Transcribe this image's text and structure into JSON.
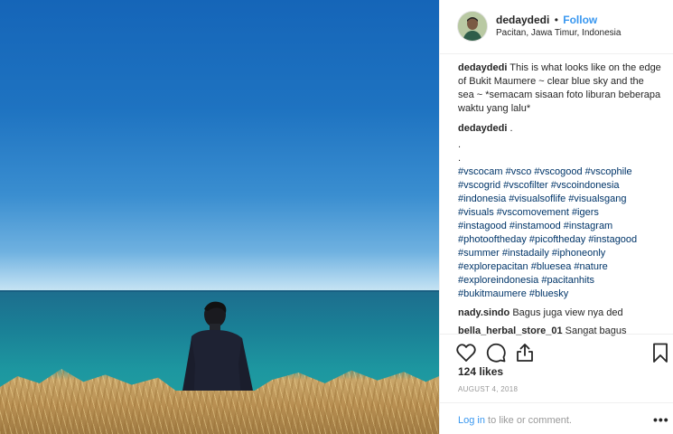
{
  "header": {
    "username": "dedaydedi",
    "separator": "•",
    "follow_label": "Follow",
    "location": "Pacitan, Jawa Timur, Indonesia"
  },
  "caption": {
    "username": "dedaydedi",
    "text": "This is what looks like on the edge of Bukit Maumere ~ clear blue sky and the sea ~ *semacam sisaan foto liburan beberapa waktu yang lalu*"
  },
  "comment2": {
    "username": "dedaydedi",
    "text": ".",
    "dot1": ".",
    "dot2": ".",
    "tag_lines": [
      "#vscocam #vsco #vscogood #vscophile",
      "#vscogrid #vscofilter #vscoindonesia",
      "#indonesia #visualsoflife #visualsgang",
      "#visuals #vscomovement #igers",
      "#instagood #instamood #instagram",
      "#photooftheday #picoftheday #instagood",
      "#summer #instadaily #iphoneonly",
      "#explorepacitan #bluesea #nature",
      "#exploreindonesia #pacitanhits",
      "#bukitmaumere #bluesky"
    ]
  },
  "comment3": {
    "username": "nady.sindo",
    "text": "Bagus juga view nya ded"
  },
  "comment4": {
    "username": "bella_herbal_store_01",
    "text": "Sangat bagus"
  },
  "actions": {
    "icons": [
      "heart-icon",
      "comment-icon",
      "share-icon",
      "bookmark-icon"
    ]
  },
  "likes": "124 likes",
  "date": "AUGUST 4, 2018",
  "footer": {
    "login_link": "Log in",
    "login_text": " to like or comment.",
    "more": "•••"
  },
  "colors": {
    "link": "#3897f0",
    "hashtag": "#003569",
    "muted": "#999999",
    "text": "#262626"
  }
}
